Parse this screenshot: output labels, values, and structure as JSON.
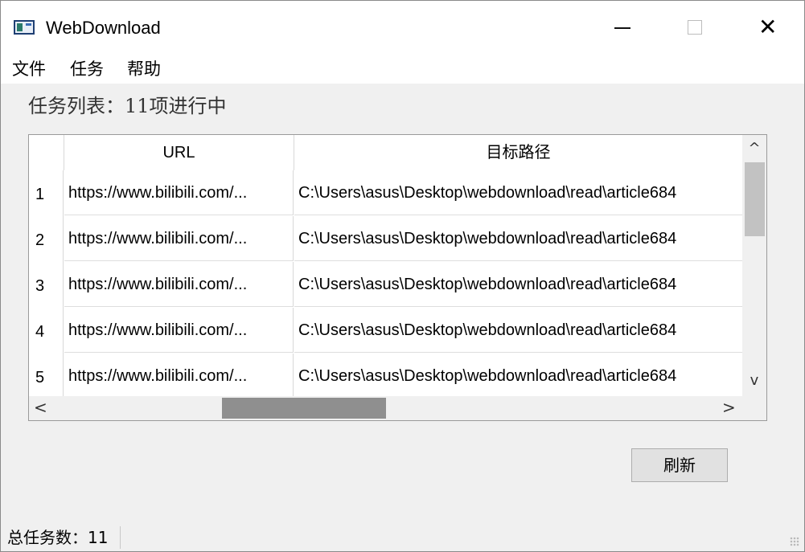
{
  "window": {
    "title": "WebDownload",
    "minimize_icon": "minimize-icon",
    "maximize_icon": "maximize-icon",
    "close_icon": "close-icon",
    "close_glyph": "✕"
  },
  "menu": {
    "items": [
      {
        "label": "文件"
      },
      {
        "label": "任务"
      },
      {
        "label": "帮助"
      }
    ]
  },
  "task_list": {
    "title": "任务列表：11项进行中"
  },
  "table": {
    "columns": [
      "URL",
      "目标路径"
    ],
    "rows": [
      {
        "num": "1",
        "url": "https://www.bilibili.com/...",
        "path": "C:\\Users\\asus\\Desktop\\webdownload\\read\\article684"
      },
      {
        "num": "2",
        "url": "https://www.bilibili.com/...",
        "path": "C:\\Users\\asus\\Desktop\\webdownload\\read\\article684"
      },
      {
        "num": "3",
        "url": "https://www.bilibili.com/...",
        "path": "C:\\Users\\asus\\Desktop\\webdownload\\read\\article684"
      },
      {
        "num": "4",
        "url": "https://www.bilibili.com/...",
        "path": "C:\\Users\\asus\\Desktop\\webdownload\\read\\article684"
      },
      {
        "num": "5",
        "url": "https://www.bilibili.com/...",
        "path": "C:\\Users\\asus\\Desktop\\webdownload\\read\\article684"
      }
    ],
    "scroll": {
      "up_glyph": "^",
      "down_glyph": "v",
      "left_glyph": "<",
      "right_glyph": ">"
    }
  },
  "buttons": {
    "refresh": "刷新"
  },
  "status": {
    "total_tasks": "总任务数：11"
  }
}
